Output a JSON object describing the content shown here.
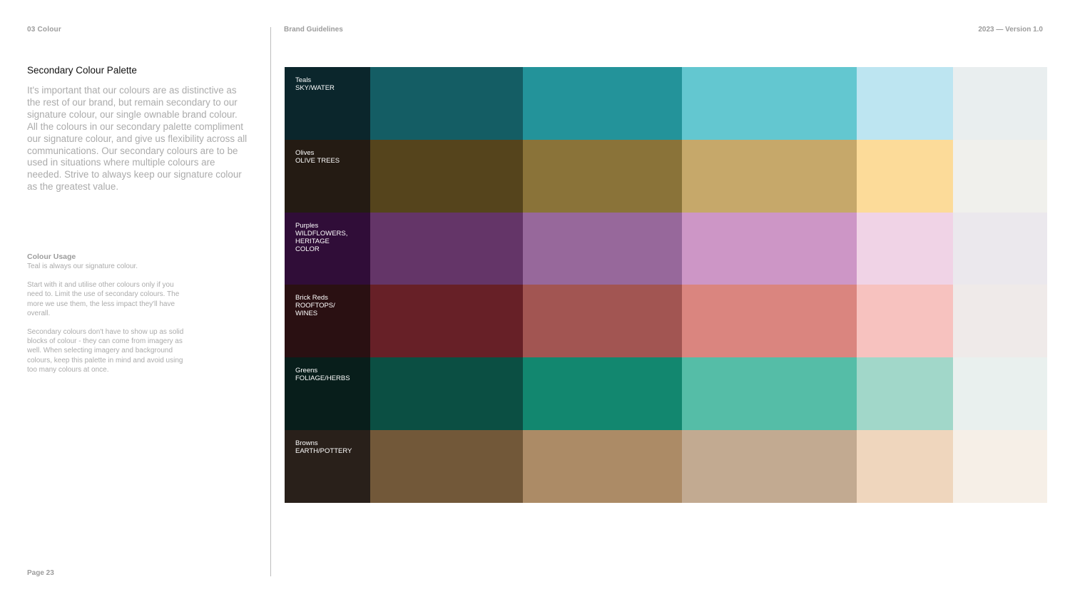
{
  "header": {
    "section": "03  Colour",
    "document": "Brand Guidelines",
    "version": "2023 — Version 1.0"
  },
  "content": {
    "heading": "Secondary Colour Palette",
    "intro": "It's important that our colours are as distinctive as the rest of our brand, but remain secondary to our signature colour, our single ownable brand colour. All the colours in our secondary palette compliment our signature colour, and give us flexibility across all communications. Our secondary colours are to be used in situations where multiple colours are needed. Strive to always keep our signature colour as the greatest value.",
    "usage": {
      "title": "Colour Usage",
      "paragraphs": [
        "Teal is always our signature colour.",
        "Start with it and utilise other colours only if you need to. Limit the use of secondary colours. The more we use them, the less impact they'll have overall.",
        "Secondary colours don't have to show up as solid blocks of colour - they can come from imagery as well. When selecting imagery and background colours, keep this palette in mind and avoid using too many colours at once."
      ]
    }
  },
  "palette": [
    {
      "name": "Teals",
      "description": "SKY/WATER",
      "swatches": [
        "#0b262c",
        "#145d64",
        "#23939a",
        "#63c7d0",
        "#bde5f1",
        "#e9eeef"
      ]
    },
    {
      "name": "Olives",
      "description": "OLIVE TREES",
      "swatches": [
        "#241b13",
        "#55441c",
        "#8a7339",
        "#c6a86a",
        "#fcdb99",
        "#f0f0ec"
      ]
    },
    {
      "name": "Purples",
      "description": "WILDFLOWERS, HERITAGE COLOR",
      "swatches": [
        "#300d38",
        "#643568",
        "#97689b",
        "#cd96c6",
        "#f0d3e6",
        "#ebe8ed"
      ]
    },
    {
      "name": "Brick Reds",
      "description": "ROOFTOPS/ WINES",
      "swatches": [
        "#2a1012",
        "#672027",
        "#a25552",
        "#da857f",
        "#f7c2bf",
        "#efeae9"
      ]
    },
    {
      "name": "Greens",
      "description": "FOLIAGE/HERBS",
      "swatches": [
        "#081e1b",
        "#0b4f43",
        "#12876f",
        "#55bda7",
        "#a1d7c9",
        "#e9f0ee"
      ]
    },
    {
      "name": "Browns",
      "description": "EARTH/POTTERY",
      "swatches": [
        "#29201a",
        "#725839",
        "#ac8b66",
        "#c2aa91",
        "#efd6bd",
        "#f6efe7"
      ]
    }
  ],
  "footer": {
    "page": "Page 23"
  }
}
